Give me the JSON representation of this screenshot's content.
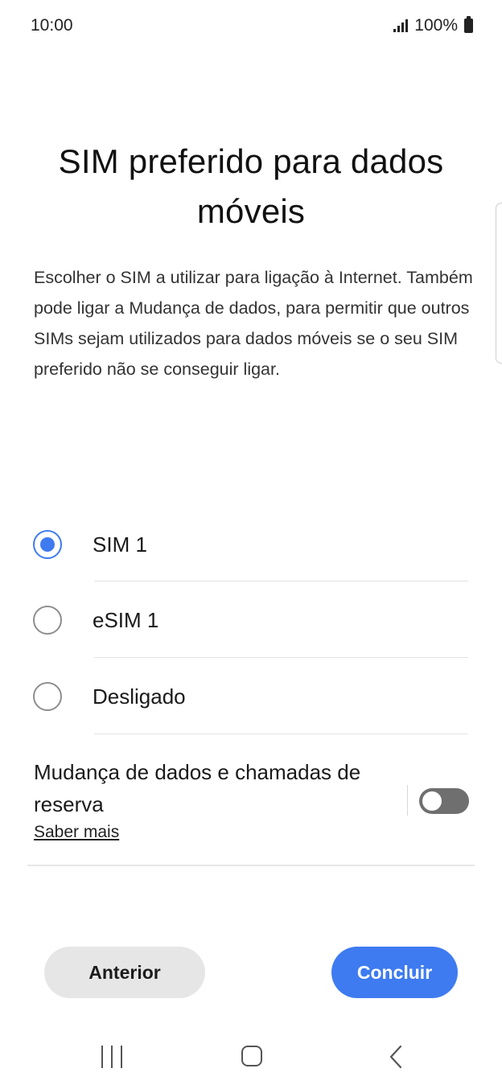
{
  "status_bar": {
    "time": "10:00",
    "battery": "100%",
    "icons": [
      "signal-icon",
      "battery-icon"
    ]
  },
  "header": {
    "title": "SIM preferido para dados móveis"
  },
  "description": "Escolher o SIM a utilizar para ligação à Internet. Também pode ligar a Mudança de dados, para permitir que outros SIMs sejam utilizados para dados móveis se o seu SIM preferido não se conseguir ligar.",
  "sim_options": [
    {
      "label": "SIM 1",
      "selected": true
    },
    {
      "label": "eSIM 1",
      "selected": false
    },
    {
      "label": "Desligado",
      "selected": false
    }
  ],
  "backup_switch": {
    "title": "Mudança de dados e chamadas de reserva",
    "link": "Saber mais",
    "enabled": false
  },
  "buttons": {
    "previous": "Anterior",
    "finish": "Concluir"
  },
  "colors": {
    "accent": "#3e7bf0",
    "toggle_off": "#6f6f6f",
    "secondary_button": "#e6e6e6"
  },
  "nav_bar": {
    "icons": [
      "recents-icon",
      "home-icon",
      "back-icon"
    ]
  }
}
